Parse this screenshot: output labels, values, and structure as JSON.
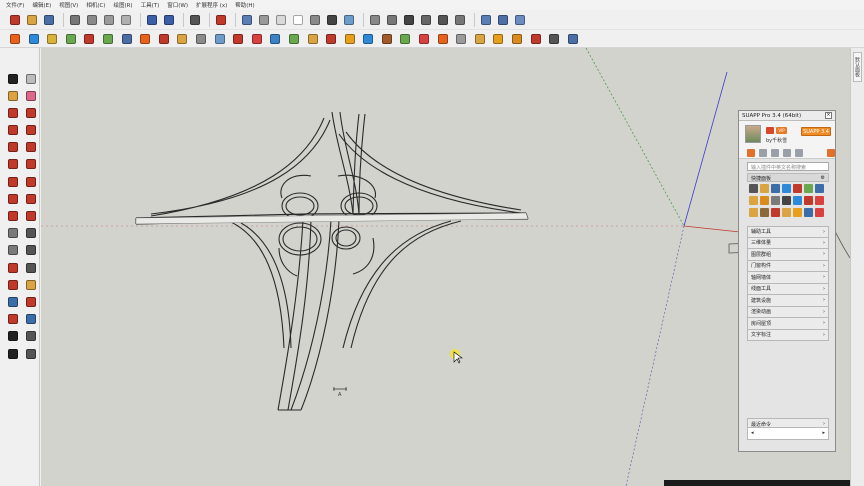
{
  "menu": [
    {
      "label": "文件(F)"
    },
    {
      "label": "编辑(E)"
    },
    {
      "label": "视图(V)"
    },
    {
      "label": "相机(C)"
    },
    {
      "label": "绘图(R)"
    },
    {
      "label": "工具(T)"
    },
    {
      "label": "窗口(W)"
    },
    {
      "label": "扩展程序 (x)"
    },
    {
      "label": "帮助(H)"
    }
  ],
  "toolbar_row1": [
    {
      "icon": "new-model-icon",
      "color": "#c0392b"
    },
    {
      "icon": "open-folder-icon",
      "color": "#d9a441"
    },
    {
      "icon": "save-icon",
      "color": "#4a6fa5"
    },
    {
      "sep": true
    },
    {
      "icon": "cut-icon",
      "color": "#777777"
    },
    {
      "icon": "copy-icon",
      "color": "#8a8a8a"
    },
    {
      "icon": "paste-icon",
      "color": "#9a9a9a"
    },
    {
      "icon": "erase-icon",
      "color": "#b0b0b0"
    },
    {
      "sep": true
    },
    {
      "icon": "undo-icon",
      "color": "#3a5ea8"
    },
    {
      "icon": "redo-icon",
      "color": "#3a5ea8"
    },
    {
      "sep": true
    },
    {
      "icon": "print-icon",
      "color": "#555555"
    },
    {
      "sep": true
    },
    {
      "icon": "model-info-icon",
      "color": "#c0392b"
    },
    {
      "sep": true
    },
    {
      "icon": "xray-icon",
      "color": "#5b7fb5"
    },
    {
      "icon": "back-edges-icon",
      "color": "#9a9a9a"
    },
    {
      "icon": "wireframe-icon",
      "color": "#d8d8d8"
    },
    {
      "icon": "hidden-line-icon",
      "color": "#ffffff"
    },
    {
      "icon": "shaded-icon",
      "color": "#8a8a8a"
    },
    {
      "icon": "shaded-textures-icon",
      "color": "#444444"
    },
    {
      "icon": "monochrome-icon",
      "color": "#6f9bc9"
    },
    {
      "sep": true
    },
    {
      "icon": "iso-view-icon",
      "color": "#888888"
    },
    {
      "icon": "top-view-icon",
      "color": "#777777"
    },
    {
      "icon": "front-view-icon",
      "color": "#444444"
    },
    {
      "icon": "right-view-icon",
      "color": "#666666"
    },
    {
      "icon": "back-view-icon",
      "color": "#555555"
    },
    {
      "icon": "left-view-icon",
      "color": "#777777"
    },
    {
      "sep": true
    },
    {
      "icon": "component-icon-a",
      "color": "#5b7fb5"
    },
    {
      "icon": "component-icon-b",
      "color": "#4f6fa8"
    },
    {
      "icon": "component-icon-c",
      "color": "#6a8cc3"
    }
  ],
  "toolbar_row2_colors": [
    "#e8621c",
    "#2e8ad8",
    "#d9b23a",
    "#6aa84f",
    "#c0392b",
    "#6aa84f",
    "#4a6fa5",
    "#e8621c",
    "#c0392b",
    "#d9a441",
    "#8a8a8a",
    "#6f9bc9",
    "#c0392b",
    "#d94040",
    "#3b82c4",
    "#6aa84f",
    "#d9a441",
    "#c0392b",
    "#e8a01c",
    "#2e8ad8",
    "#a05a2c",
    "#6aa84f",
    "#d94040",
    "#e8621c",
    "#9a9a9a",
    "#d9a441",
    "#e8a01c",
    "#d98b1c",
    "#c0392b",
    "#555555",
    "#4a6fa5"
  ],
  "left_tools": [
    {
      "icon": "select-arrow-icon",
      "color": "#222222"
    },
    {
      "icon": "make-component-icon",
      "color": "#bbbbbb"
    },
    {
      "icon": "paint-bucket-icon",
      "color": "#d9a441"
    },
    {
      "icon": "eraser-icon",
      "color": "#d96a8a"
    },
    {
      "icon": "line-pencil-icon",
      "color": "#c0392b"
    },
    {
      "icon": "freehand-icon",
      "color": "#c0392b"
    },
    {
      "icon": "rectangle-icon",
      "color": "#c0392b"
    },
    {
      "icon": "rotated-rectangle-icon",
      "color": "#c0392b"
    },
    {
      "icon": "circle-icon",
      "color": "#c0392b"
    },
    {
      "icon": "polygon-icon",
      "color": "#c0392b"
    },
    {
      "icon": "arc-icon",
      "color": "#c0392b"
    },
    {
      "icon": "pie-icon",
      "color": "#c0392b"
    },
    {
      "icon": "move-icon",
      "color": "#c0392b"
    },
    {
      "icon": "push-pull-icon",
      "color": "#c0392b"
    },
    {
      "icon": "rotate-icon",
      "color": "#c0392b"
    },
    {
      "icon": "follow-me-icon",
      "color": "#c0392b"
    },
    {
      "icon": "scale-icon",
      "color": "#c0392b"
    },
    {
      "icon": "offset-icon",
      "color": "#c0392b"
    },
    {
      "icon": "tape-measure-icon",
      "color": "#7a7a7a"
    },
    {
      "icon": "dimension-icon",
      "color": "#555555"
    },
    {
      "icon": "protractor-icon",
      "color": "#7a7a7a"
    },
    {
      "icon": "text-label-icon",
      "color": "#555555"
    },
    {
      "icon": "axes-icon",
      "color": "#c0392b"
    },
    {
      "icon": "3d-text-icon",
      "color": "#555555"
    },
    {
      "icon": "orbit-icon",
      "color": "#c0392b"
    },
    {
      "icon": "pan-hand-icon",
      "color": "#d9a441"
    },
    {
      "icon": "zoom-icon",
      "color": "#3b6ea8"
    },
    {
      "icon": "zoom-window-icon",
      "color": "#c0392b"
    },
    {
      "icon": "zoom-extents-icon",
      "color": "#c0392b"
    },
    {
      "icon": "previous-view-icon",
      "color": "#3b6ea8"
    },
    {
      "icon": "position-camera-icon",
      "color": "#222222"
    },
    {
      "icon": "look-around-icon",
      "color": "#555555"
    },
    {
      "icon": "walk-icon",
      "color": "#222222"
    },
    {
      "icon": "section-plane-icon",
      "color": "#555555"
    }
  ],
  "right_tab": {
    "label": "默认面板"
  },
  "suapp": {
    "title": "SUAPP Pro 3.4 (64bit)",
    "close": "×",
    "vip_badge": "VIP",
    "username": "by千秋雪",
    "app_button": "SUAPP 3.4",
    "search_placeholder": "输入插件中英文名称搜索",
    "quick_panel": "快捷面板",
    "quick_panel_settings": "⚙",
    "sections": [
      {
        "label": "辅助工具"
      },
      {
        "label": "三维体量"
      },
      {
        "label": "图层群组"
      },
      {
        "label": "门窗构件"
      },
      {
        "label": "轴网墙体"
      },
      {
        "label": "线面工具"
      },
      {
        "label": "建筑设施"
      },
      {
        "label": "渲染动画"
      },
      {
        "label": "房间屋顶"
      },
      {
        "label": "文字标注"
      }
    ],
    "section_arrow": "›",
    "recent": "最近命令",
    "recent_arrow": "›",
    "recent_left": "◂",
    "recent_right": "▸",
    "quick_icon_colors": [
      "#555555",
      "#d9a441",
      "#3b6ea8",
      "#2e8ad8",
      "#c0392b",
      "#6aa84f",
      "#3b6ea8",
      "#d9a441",
      "#d98b1c",
      "#7a7a7a",
      "#444444",
      "#2e8ad8",
      "#c0392b",
      "#d94040",
      "#d9a441",
      "#8a6a3a",
      "#c0392b",
      "#d9a441",
      "#e8a01c",
      "#3b6ea8",
      "#d94040"
    ]
  },
  "viewport": {
    "cursor_highlight": "#f3e23a",
    "dim_text": "A"
  }
}
